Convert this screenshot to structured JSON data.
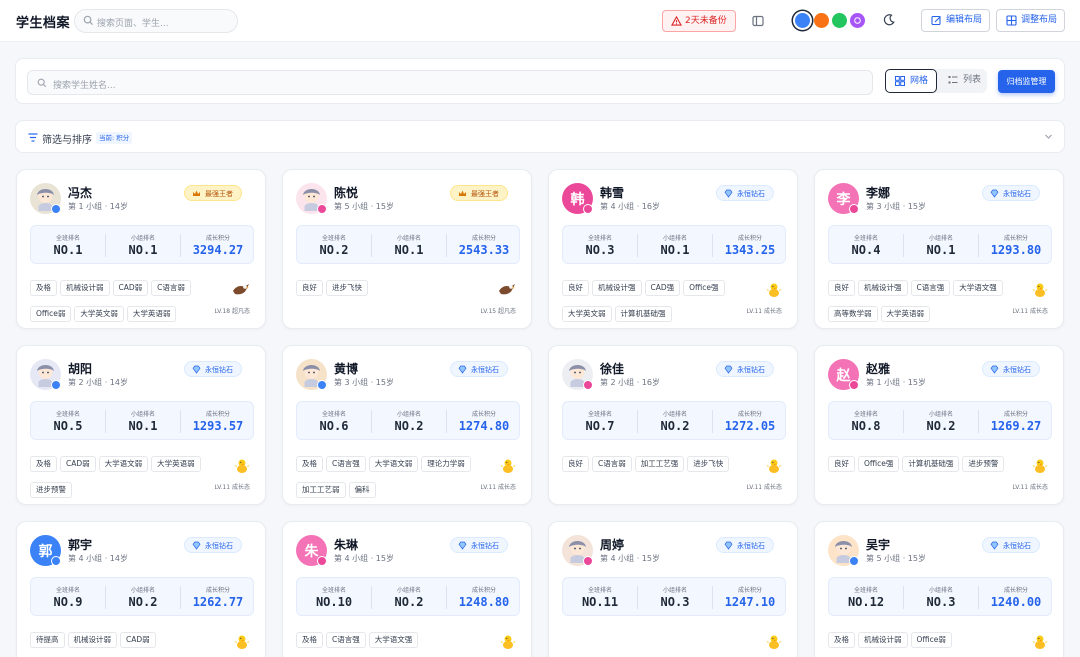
{
  "header": {
    "title": "学生档案",
    "search_placeholder": "搜索页面、学生...",
    "backup_warning": "2天未备份",
    "edit_layout": "编辑布局",
    "adjust_layout": "调整布局",
    "theme_colors": [
      "#3b82f6",
      "#f97316",
      "#22c55e",
      "#a855f7"
    ]
  },
  "toolbar": {
    "search_placeholder": "搜索学生姓名...",
    "view_grid": "网格",
    "view_list": "列表",
    "manage_button": "归档监管理"
  },
  "filter": {
    "title": "筛选与排序",
    "badge": "当前: 积分"
  },
  "labels": {
    "overall_rank": "全班排名",
    "group_rank": "小组排名",
    "growth_score": "成长积分"
  },
  "students": [
    {
      "name": "冯杰",
      "sub": "第 1 小组 · 14岁",
      "rank_title": "最强王者",
      "rank_type": "king",
      "overall": "NO.1",
      "group": "NO.1",
      "score": "3294.27",
      "tags": [
        "及格",
        "机械设计弱",
        "CAD弱",
        "C语言弱",
        "Office弱",
        "大学英文弱",
        "大学英语弱"
      ],
      "level": "LV.18 超凡态",
      "avatar": {
        "type": "image",
        "color": "#e9e3d5",
        "gender": "male"
      },
      "mascot": "eagle-icon"
    },
    {
      "name": "陈悦",
      "sub": "第 5 小组 · 15岁",
      "rank_title": "最强王者",
      "rank_type": "king",
      "overall": "NO.2",
      "group": "NO.1",
      "score": "2543.33",
      "tags": [
        "良好",
        "进步飞快"
      ],
      "level": "LV.15 超凡态",
      "avatar": {
        "type": "image",
        "color": "#fbe4ec",
        "gender": "female"
      },
      "mascot": "eagle-icon"
    },
    {
      "name": "韩雪",
      "sub": "第 4 小组 · 16岁",
      "rank_title": "永恒钻石",
      "rank_type": "diamond",
      "overall": "NO.3",
      "group": "NO.1",
      "score": "1343.25",
      "tags": [
        "良好",
        "机械设计强",
        "CAD强",
        "Office强",
        "大学英文弱",
        "计算机基础强"
      ],
      "level": "LV.11 成长态",
      "avatar": {
        "type": "letter",
        "letter": "韩",
        "color": "#ec4899",
        "gender": "female"
      },
      "mascot": "chick-icon"
    },
    {
      "name": "李娜",
      "sub": "第 3 小组 · 15岁",
      "rank_title": "永恒钻石",
      "rank_type": "diamond",
      "overall": "NO.4",
      "group": "NO.1",
      "score": "1293.80",
      "tags": [
        "良好",
        "机械设计强",
        "C语言强",
        "大学语文强",
        "高等数学弱",
        "大学英语弱"
      ],
      "level": "LV.11 成长态",
      "avatar": {
        "type": "letter",
        "letter": "李",
        "color": "#f472b6",
        "gender": "female"
      },
      "mascot": "chick-icon"
    },
    {
      "name": "胡阳",
      "sub": "第 2 小组 · 14岁",
      "rank_title": "永恒钻石",
      "rank_type": "diamond",
      "overall": "NO.5",
      "group": "NO.1",
      "score": "1293.57",
      "tags": [
        "及格",
        "CAD弱",
        "大学语文弱",
        "大学英语弱",
        "进步预警"
      ],
      "level": "LV.11 成长态",
      "avatar": {
        "type": "image",
        "color": "#e6e9f5",
        "gender": "male"
      },
      "mascot": "chick-icon"
    },
    {
      "name": "黄博",
      "sub": "第 3 小组 · 15岁",
      "rank_title": "永恒钻石",
      "rank_type": "diamond",
      "overall": "NO.6",
      "group": "NO.2",
      "score": "1274.80",
      "tags": [
        "及格",
        "C语言强",
        "大学语文弱",
        "理论力学弱",
        "加工工艺弱",
        "偏科"
      ],
      "level": "LV.11 成长态",
      "avatar": {
        "type": "image",
        "color": "#f6e2c8",
        "gender": "male"
      },
      "mascot": "chick-icon"
    },
    {
      "name": "徐佳",
      "sub": "第 2 小组 · 16岁",
      "rank_title": "永恒钻石",
      "rank_type": "diamond",
      "overall": "NO.7",
      "group": "NO.2",
      "score": "1272.05",
      "tags": [
        "良好",
        "C语言弱",
        "加工工艺强",
        "进步飞快"
      ],
      "level": "LV.11 成长态",
      "avatar": {
        "type": "image",
        "color": "#eceef2",
        "gender": "female"
      },
      "mascot": "chick-icon"
    },
    {
      "name": "赵雅",
      "sub": "第 1 小组 · 15岁",
      "rank_title": "永恒钻石",
      "rank_type": "diamond",
      "overall": "NO.8",
      "group": "NO.2",
      "score": "1269.27",
      "tags": [
        "良好",
        "Office强",
        "计算机基础强",
        "进步预警"
      ],
      "level": "LV.11 成长态",
      "avatar": {
        "type": "letter",
        "letter": "赵",
        "color": "#f472b6",
        "gender": "female"
      },
      "mascot": "chick-icon"
    },
    {
      "name": "郭宇",
      "sub": "第 4 小组 · 14岁",
      "rank_title": "永恒钻石",
      "rank_type": "diamond",
      "overall": "NO.9",
      "group": "NO.2",
      "score": "1262.77",
      "tags": [
        "待提高",
        "机械设计弱",
        "CAD弱"
      ],
      "level": "",
      "avatar": {
        "type": "letter",
        "letter": "郭",
        "color": "#3b82f6",
        "gender": "male"
      },
      "mascot": "chick-icon"
    },
    {
      "name": "朱琳",
      "sub": "第 4 小组 · 15岁",
      "rank_title": "永恒钻石",
      "rank_type": "diamond",
      "overall": "NO.10",
      "group": "NO.2",
      "score": "1248.80",
      "tags": [
        "及格",
        "C语言强",
        "大学语文强"
      ],
      "level": "",
      "avatar": {
        "type": "letter",
        "letter": "朱",
        "color": "#f472b6",
        "gender": "female"
      },
      "mascot": "chick-icon"
    },
    {
      "name": "周婷",
      "sub": "第 4 小组 · 15岁",
      "rank_title": "永恒钻石",
      "rank_type": "diamond",
      "overall": "NO.11",
      "group": "NO.3",
      "score": "1247.10",
      "tags": [],
      "level": "",
      "avatar": {
        "type": "image",
        "color": "#f3e3d8",
        "gender": "female"
      },
      "mascot": "chick-icon"
    },
    {
      "name": "吴宇",
      "sub": "第 5 小组 · 15岁",
      "rank_title": "永恒钻石",
      "rank_type": "diamond",
      "overall": "NO.12",
      "group": "NO.3",
      "score": "1240.00",
      "tags": [
        "及格",
        "机械设计弱",
        "Office弱"
      ],
      "level": "",
      "avatar": {
        "type": "image",
        "color": "#fde3c8",
        "gender": "male"
      },
      "mascot": "chick-icon"
    }
  ]
}
